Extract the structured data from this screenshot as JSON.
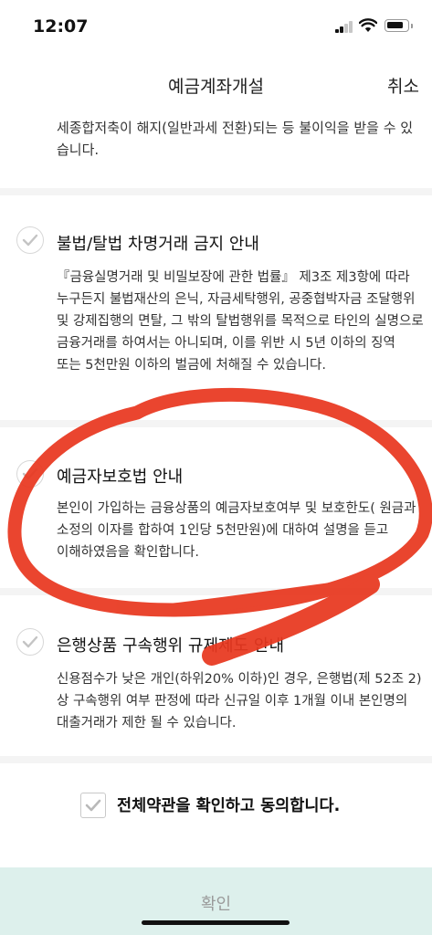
{
  "status_bar": {
    "time": "12:07"
  },
  "nav": {
    "title": "예금계좌개설",
    "cancel_label": "취소"
  },
  "sections": [
    {
      "checked": true,
      "title": "",
      "body": "세종합저축이 해지(일반과세 전환)되는 등 불이익을 받을 수 있습니다."
    },
    {
      "checked": true,
      "title": "불법/탈법 차명거래 금지 안내",
      "body": "『금융실명거래 및 비밀보장에 관한 법률』 제3조 제3항에 따라 누구든지 불법재산의 은닉, 자금세탁행위, 공중협박자금 조달행위 및 강제집행의 면탈, 그 밖의 탈법행위를 목적으로 타인의 실명으로 금융거래를 하여서는 아니되며, 이를 위반 시 5년 이하의 징역 또는 5천만원 이하의 벌금에 처해질 수 있습니다."
    },
    {
      "checked": true,
      "title": "예금자보호법 안내",
      "body": "본인이 가입하는 금융상품의 예금자보호여부 및 보호한도( 원금과 소정의 이자를 합하여 1인당 5천만원)에 대하여 설명을 듣고 이해하였음을 확인합니다."
    },
    {
      "checked": true,
      "title": "은행상품 구속행위 규제제도 안내",
      "body": "신용점수가 낮은 개인(하위20% 이하)인 경우, 은행법(제 52조 2)상 구속행위 여부 판정에 따라 신규일 이후 1개월 이내 본인명의 대출거래가 제한 될 수 있습니다."
    }
  ],
  "agree_all": {
    "checked": true,
    "label": "전체약관을 확인하고 동의합니다."
  },
  "confirm": {
    "label": "확인"
  },
  "colors": {
    "confirm_bg": "#ddf0ec",
    "annotation": "#e8371f",
    "check": "#c8c8c8"
  }
}
